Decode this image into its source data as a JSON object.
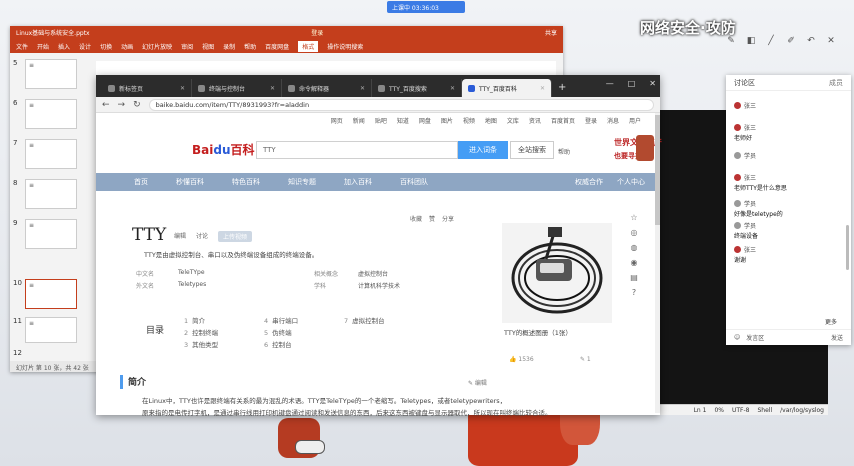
{
  "overlay": {
    "meeting": "上课中",
    "timer": "上课中 03:36:03",
    "title": "网络安全·攻防"
  },
  "ppt": {
    "title_left": "Linux基础与系统安全.pptx",
    "title_center": "登录",
    "title_right": "共享",
    "ribbon": [
      "文件",
      "开始",
      "插入",
      "设计",
      "切换",
      "动画",
      "幻灯片放映",
      "审阅",
      "视图",
      "录制",
      "帮助",
      "百度网盘",
      "格式",
      "操作说明搜索"
    ],
    "ribbon_active": "格式",
    "slide_numbers": [
      "5",
      "6",
      "7",
      "8",
      "9",
      "10",
      "11",
      "12"
    ],
    "status": "幻灯片 第 10 张，共 42 张"
  },
  "browser": {
    "tabs": [
      {
        "label": "新标签页"
      },
      {
        "label": "终端与控制台"
      },
      {
        "label": "命令解释器"
      },
      {
        "label": "TTY_百度搜索"
      },
      {
        "label": "TTY_百度百科"
      }
    ],
    "new_tab": "+",
    "win_min": "—",
    "win_max": "□",
    "win_close": "✕",
    "back": "←",
    "forward": "→",
    "reload": "↻",
    "url": "baike.baidu.com/item/TTY/8931993?fr=aladdin"
  },
  "baike": {
    "topnav": [
      "网页",
      "新闻",
      "贴吧",
      "知道",
      "网盘",
      "图片",
      "视频",
      "地图",
      "文库",
      "资讯",
      "百度首页",
      "登录",
      "消息",
      "用户"
    ],
    "logo_text": "Bai",
    "logo_paw": "du",
    "logo_suffix": "百科",
    "search_value": "TTY",
    "enter_button": "进入词条",
    "search_button": "全站搜索",
    "help": "帮助",
    "promo_line1": "世界文化遗产",
    "promo_line2": "也要寻找",
    "categories": [
      "首页",
      "秒懂百科",
      "特色百科",
      "知识专题",
      "加入百科",
      "百科团队"
    ],
    "cat_right": [
      "权威合作",
      "个人中心"
    ],
    "title": "TTY",
    "title_actions": [
      "编辑",
      "讨论",
      "上传视频"
    ],
    "share": [
      "收藏",
      "赞",
      "分享"
    ],
    "summary": "TTY是由虚拟控制台、串口以及伪终端设备组成的终端设备。",
    "info": [
      {
        "k": "中文名",
        "v": "TeleTYpe"
      },
      {
        "k": "外文名",
        "v": "Teletypes"
      },
      {
        "k": "相关概念",
        "v": "虚拟控制台"
      },
      {
        "k": "学科",
        "v": "计算机科学技术"
      }
    ],
    "toc_label": "目录",
    "toc": [
      {
        "n": "1",
        "t": "简介"
      },
      {
        "n": "2",
        "t": "控制终端"
      },
      {
        "n": "3",
        "t": "其他类型"
      },
      {
        "n": "4",
        "t": "串行端口"
      },
      {
        "n": "5",
        "t": "伪终端"
      },
      {
        "n": "6",
        "t": "控制台"
      },
      {
        "n": "7",
        "t": "虚拟控制台"
      }
    ],
    "image_caption": "TTY的概述图册（1张）",
    "like": "👍 1536",
    "like2": "✎ 1",
    "intro_title": "简介",
    "intro_edit": "✎ 编辑",
    "intro_text1": "在Linux中，TTY也许是跟终端有关系的最为混乱的术语。TTY是TeleTYpe的一个老缩写。Teletypes，或者teletypewriters，",
    "intro_text2": "原来指的是电传打字机，是通过串行线用打印机键盘通过阅读和发送信息的东西，后来这东西被键盘与显示器取代，所以现在叫终端比较合适。"
  },
  "dark_status": [
    "Ln 1",
    "0%",
    "UTF-8",
    "Shell",
    "/var/log/syslog"
  ],
  "chat": {
    "tab_active": "讨论区",
    "tab_other": "成员",
    "messages": [
      {
        "name": "张三",
        "text": "",
        "time": ""
      },
      {
        "name": "张三",
        "text": "老师好",
        "time": ""
      },
      {
        "name": "学员",
        "text": "",
        "time": ""
      },
      {
        "name": "张三",
        "text": "老师TTY是什么意思",
        "time": ""
      },
      {
        "name": "学员",
        "text": "好像是teletype的",
        "time": ""
      },
      {
        "name": "学员",
        "text": "终端设备",
        "time": ""
      },
      {
        "name": "张三",
        "text": "谢谢",
        "time": ""
      }
    ],
    "more": "更多",
    "footer": [
      "☺",
      "发言区"
    ],
    "send": "发送"
  }
}
